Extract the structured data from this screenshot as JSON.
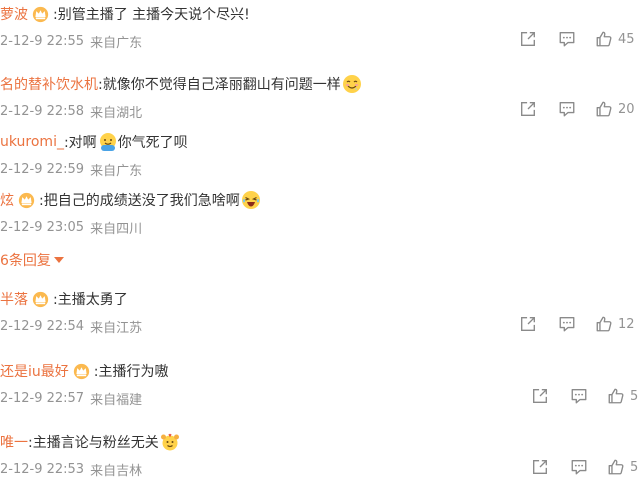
{
  "colors": {
    "username": "#eb7340",
    "text": "#333333",
    "meta": "#939393",
    "icon": "#8a8a8a"
  },
  "comments": [
    {
      "user": "萝波",
      "text": ":别管主播了 主播今天说个尽兴!",
      "time": "2-12-9 22:55",
      "location": "来自广东",
      "badge": "crown-badge-icon",
      "emoji": null,
      "likes": "45"
    },
    {
      "user": "名的替补饮水机",
      "text": ":就像你不觉得自己泽丽翻山有问题一样",
      "time": "2-12-9 22:58",
      "location": "来自湖北",
      "badge": null,
      "emoji": "drooling-face-icon",
      "likes": "20"
    },
    {
      "user": "ukuromi_",
      "text": ":对啊",
      "text_after": "你气死了呗",
      "time": "2-12-9 22:59",
      "location": "来自广东",
      "badge": null,
      "emoji": "hugging-face-icon",
      "likes": null
    },
    {
      "user": "炫",
      "text": ":把自己的成绩送没了我们急啥啊",
      "time": "2-12-9 23:05",
      "location": "来自四川",
      "badge": "crown-badge-icon",
      "emoji": "laughing-crying-face-icon",
      "likes": null
    },
    {
      "user": "半落",
      "text": ":主播太勇了",
      "time": "2-12-9 22:54",
      "location": "来自江苏",
      "badge": "crown-badge-icon",
      "emoji": null,
      "likes": "12"
    },
    {
      "user": "还是iu最好",
      "text": ":主播行为嗷",
      "time": "2-12-9 22:57",
      "location": "来自福建",
      "badge": "crown-badge-icon",
      "emoji": null,
      "likes": "5"
    },
    {
      "user": "唯一",
      "text": ":主播言论与粉丝无关",
      "time": "2-12-9 22:53",
      "location": "来自吉林",
      "badge": null,
      "emoji": "flexing-face-icon",
      "likes": "5"
    }
  ],
  "expand_replies": {
    "label": "6条回复"
  }
}
